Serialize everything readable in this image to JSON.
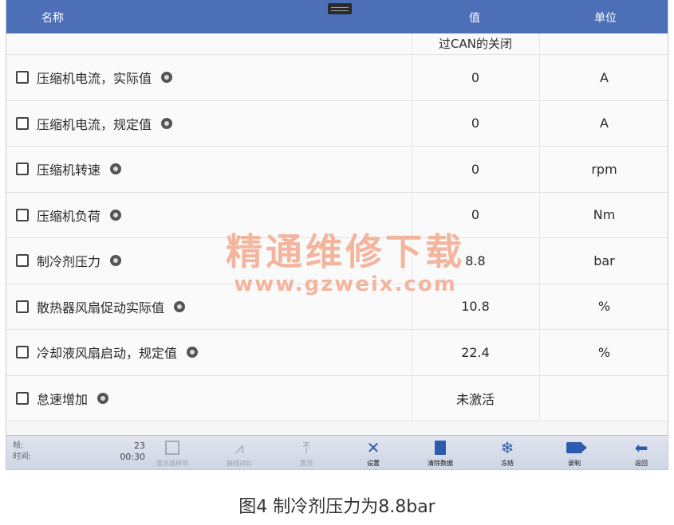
{
  "header": {
    "name_label": "名称",
    "value_label": "值",
    "unit_label": "单位"
  },
  "first_row_value": "过CAN的关闭",
  "rows": [
    {
      "name": "压缩机电流，实际值",
      "value": "0",
      "unit": "A"
    },
    {
      "name": "压缩机电流，规定值",
      "value": "0",
      "unit": "A"
    },
    {
      "name": "压缩机转速",
      "value": "0",
      "unit": "rpm"
    },
    {
      "name": "压缩机负荷",
      "value": "0",
      "unit": "Nm"
    },
    {
      "name": "制冷剂压力",
      "value": "8.8",
      "unit": "bar"
    },
    {
      "name": "散热器风扇促动实际值",
      "value": "10.8",
      "unit": "%"
    },
    {
      "name": "冷却液风扇启动，规定值",
      "value": "22.4",
      "unit": "%"
    },
    {
      "name": "怠速增加",
      "value": "未激活",
      "unit": ""
    }
  ],
  "watermark": {
    "cn": "精通维修下载",
    "url": "www.gzweix.com"
  },
  "bottombar": {
    "frame_label": "帧:",
    "time_label": "时间:",
    "frame_value": "23",
    "time_value": "00:30",
    "buttons": [
      "显示选择项",
      "曲线对比",
      "置顶",
      "设置",
      "清除数据",
      "冻结",
      "录制",
      "返回"
    ]
  },
  "caption": "图4 制冷剂压力为8.8bar"
}
